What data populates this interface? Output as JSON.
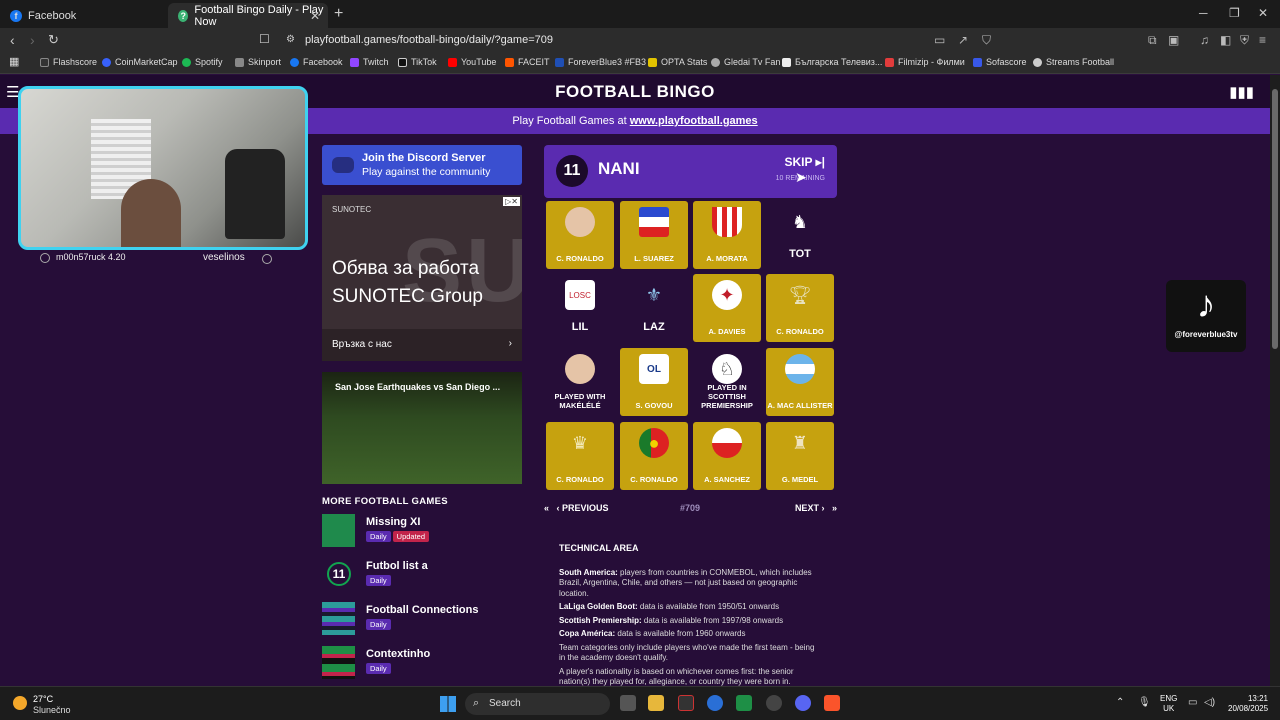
{
  "browser": {
    "tabs": [
      {
        "title": "Facebook",
        "favicon_color": "#1877f2"
      },
      {
        "title": "Football Bingo Daily - Play Now",
        "favicon_color": "#3bb273"
      }
    ],
    "url": "playfootball.games/football-bingo/daily/?game=709",
    "bookmarks": [
      {
        "label": "Flashscore",
        "color": "#333333"
      },
      {
        "label": "CoinMarketCap",
        "color": "#3861fb"
      },
      {
        "label": "Spotify",
        "color": "#1db954"
      },
      {
        "label": "Skinport",
        "color": "#888888"
      },
      {
        "label": "Facebook",
        "color": "#1877f2"
      },
      {
        "label": "Twitch",
        "color": "#9146ff"
      },
      {
        "label": "TikTok",
        "color": "#111111"
      },
      {
        "label": "YouTube",
        "color": "#ff0000"
      },
      {
        "label": "FACEIT",
        "color": "#ff5500"
      },
      {
        "label": "ForeverBlue3 #FB3",
        "color": "#1f4fb5"
      },
      {
        "label": "OPTA Stats",
        "color": "#e2c400"
      },
      {
        "label": "Gledai Tv Fan",
        "color": "#aaaaaa"
      },
      {
        "label": "Българска Телевиз...",
        "color": "#eeeeee"
      },
      {
        "label": "Filmizip - Филми",
        "color": "#e23c3c"
      },
      {
        "label": "Sofascore",
        "color": "#3858e9"
      },
      {
        "label": "Streams Football",
        "color": "#cccccc"
      }
    ]
  },
  "site": {
    "title": "FOOTBALL BINGO",
    "promo_text": "Play Football Games at ",
    "promo_link": "www.playfootball.games"
  },
  "webcam": {
    "left_text": "m00n57ruck 4.20",
    "right_text": "veselinos"
  },
  "discord": {
    "title": "Join the Discord Server",
    "subtitle": "Play against the community"
  },
  "ad": {
    "brand": "SUNOTEC",
    "headline": "Обява за работа SUNOTEC Group",
    "deco": "SUNO",
    "cta": "Връзка с нас"
  },
  "video": {
    "title": "San Jose Earthquakes vs San Diego ..."
  },
  "more_games": {
    "title": "MORE FOOTBALL GAMES",
    "items": [
      {
        "name": "Missing XI",
        "badges": [
          "Daily",
          "Updated"
        ],
        "color": "#1f8a4c"
      },
      {
        "name": "Futbol list a",
        "badges": [
          "Daily"
        ],
        "color": "#11a44f"
      },
      {
        "name": "Football Connections",
        "badges": [
          "Daily"
        ],
        "color": "#2c9c9a"
      },
      {
        "name": "Contextinho",
        "badges": [
          "Daily"
        ],
        "color": "#1e8f46"
      }
    ]
  },
  "bingo": {
    "current_number": "11",
    "current_player": "NANI",
    "skip_label": "SKIP",
    "remaining_label": "10 REMAINING",
    "cells": [
      {
        "label": "C. RONALDO",
        "filled": true,
        "icon": "face"
      },
      {
        "label": "L. SUAREZ",
        "filled": true,
        "icon": "flags"
      },
      {
        "label": "A. MORATA",
        "filled": true,
        "icon": "crest"
      },
      {
        "label": "TOT",
        "filled": false,
        "icon": "cockerel"
      },
      {
        "label": "LIL",
        "filled": false,
        "icon": "lille-crest"
      },
      {
        "label": "LAZ",
        "filled": false,
        "icon": "eagle"
      },
      {
        "label": "A. DAVIES",
        "filled": true,
        "icon": "canada-flag"
      },
      {
        "label": "C. RONALDO",
        "filled": true,
        "icon": "trophy"
      },
      {
        "label": "PLAYED WITH MAKÉLÉLÉ",
        "filled": false,
        "icon": "face"
      },
      {
        "label": "S. GOVOU",
        "filled": true,
        "icon": "lyon-crest"
      },
      {
        "label": "PLAYED IN SCOTTISH PREMIERSHIP",
        "filled": false,
        "icon": "league-logo"
      },
      {
        "label": "A. MAC ALLISTER",
        "filled": true,
        "icon": "argentina-flag"
      },
      {
        "label": "C. RONALDO",
        "filled": true,
        "icon": "boot"
      },
      {
        "label": "C. RONALDO",
        "filled": true,
        "icon": "portugal-flag"
      },
      {
        "label": "A. SANCHEZ",
        "filled": true,
        "icon": "chile-flag"
      },
      {
        "label": "G. MEDEL",
        "filled": true,
        "icon": "cup"
      }
    ],
    "prev_label": "PREVIOUS",
    "next_label": "NEXT",
    "game_number": "#709"
  },
  "technical": {
    "title": "TECHNICAL AREA",
    "notes": [
      {
        "term": "South America:",
        "text": " players from countries in CONMEBOL, which includes Brazil, Argentina, Chile, and others — not just based on geographic location."
      },
      {
        "term": "LaLiga Golden Boot:",
        "text": " data is available from 1950/51 onwards"
      },
      {
        "term": "Scottish Premiership:",
        "text": " data is available from 1997/98 onwards"
      },
      {
        "term": "Copa América:",
        "text": " data is available from 1960 onwards"
      },
      {
        "term": "",
        "text": "Team categories only include players who've made the first team - being in the academy doesn't qualify."
      },
      {
        "term": "",
        "text": "A player's nationality is based on whichever comes first: the senior nation(s) they played for, allegiance, or country they were born in."
      }
    ]
  },
  "tiktok": {
    "handle": "@foreverblue3tv"
  },
  "taskbar": {
    "temp": "27°C",
    "weather": "Slunečno",
    "search_label": "Search",
    "lang": "ENG",
    "region": "UK",
    "time": "13:21",
    "date": "20/08/2025"
  }
}
